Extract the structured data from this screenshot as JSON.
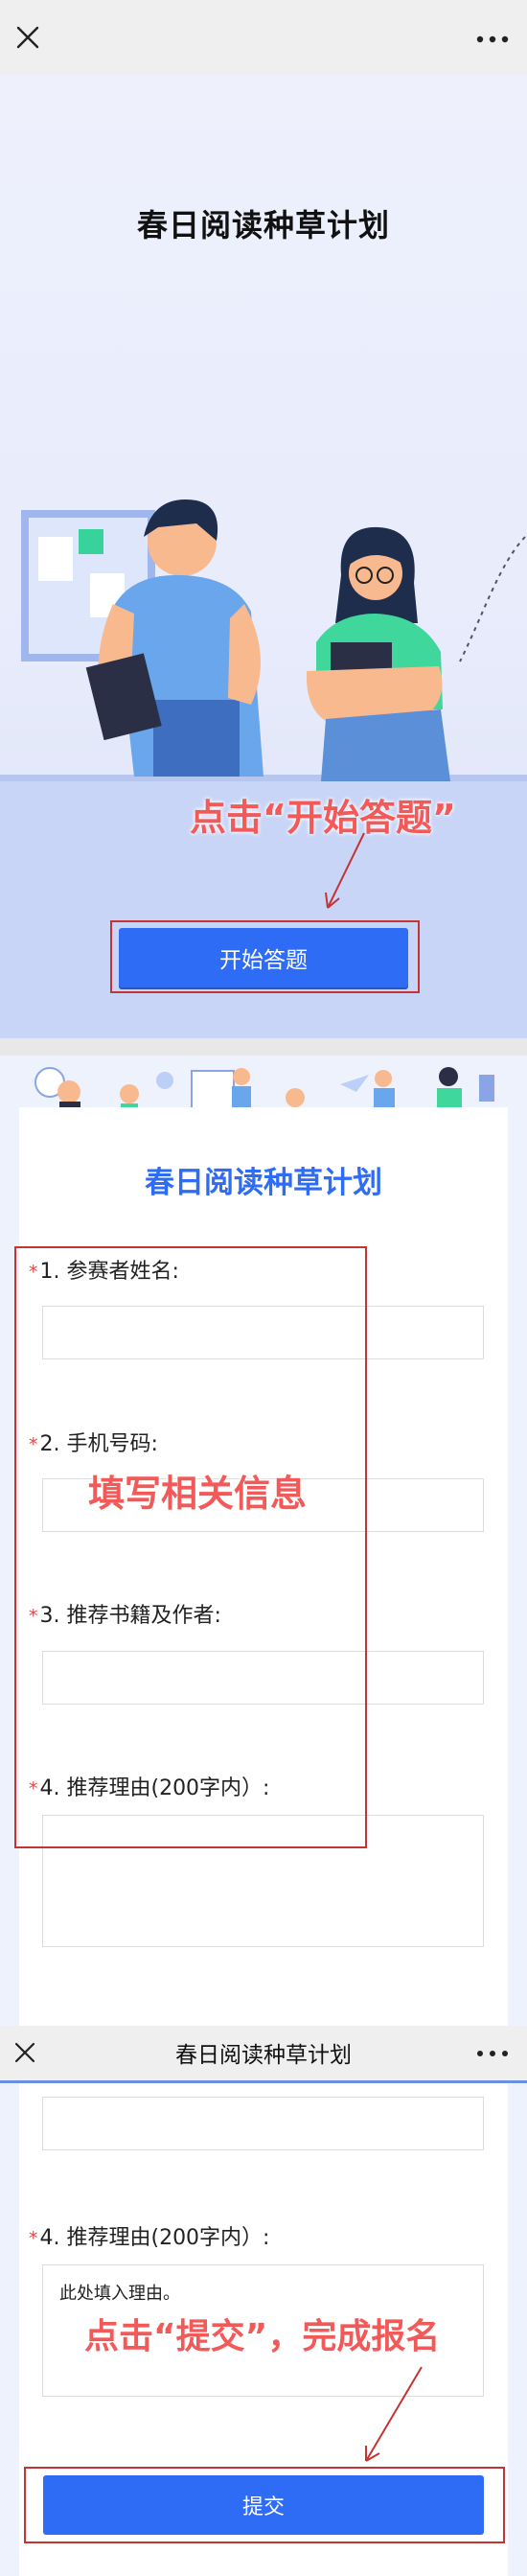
{
  "top_bar": {
    "close_icon": "close-icon",
    "more_icon": "more-icon"
  },
  "hero": {
    "title": "春日阅读种草计划",
    "annotation": "点击“开始答题”",
    "start_button": "开始答题"
  },
  "form": {
    "title": "春日阅读种草计划",
    "required_mark": "*",
    "questions": [
      {
        "label": "1. 参赛者姓名:"
      },
      {
        "label": "2. 手机号码:"
      },
      {
        "label": "3. 推荐书籍及作者:"
      },
      {
        "label": "4. 推荐理由(200字内）:"
      }
    ],
    "annotation": "填写相关信息"
  },
  "second_bar": {
    "title": "春日阅读种草计划"
  },
  "form2": {
    "question4_label": "4. 推荐理由(200字内）:",
    "reason_value": "此处填入理由。",
    "annotation": "点击“提交”，完成报名",
    "submit_button": "提交"
  },
  "colors": {
    "accent": "#2f6cf6",
    "annotation": "#f25a5a",
    "frame": "#c43434"
  }
}
